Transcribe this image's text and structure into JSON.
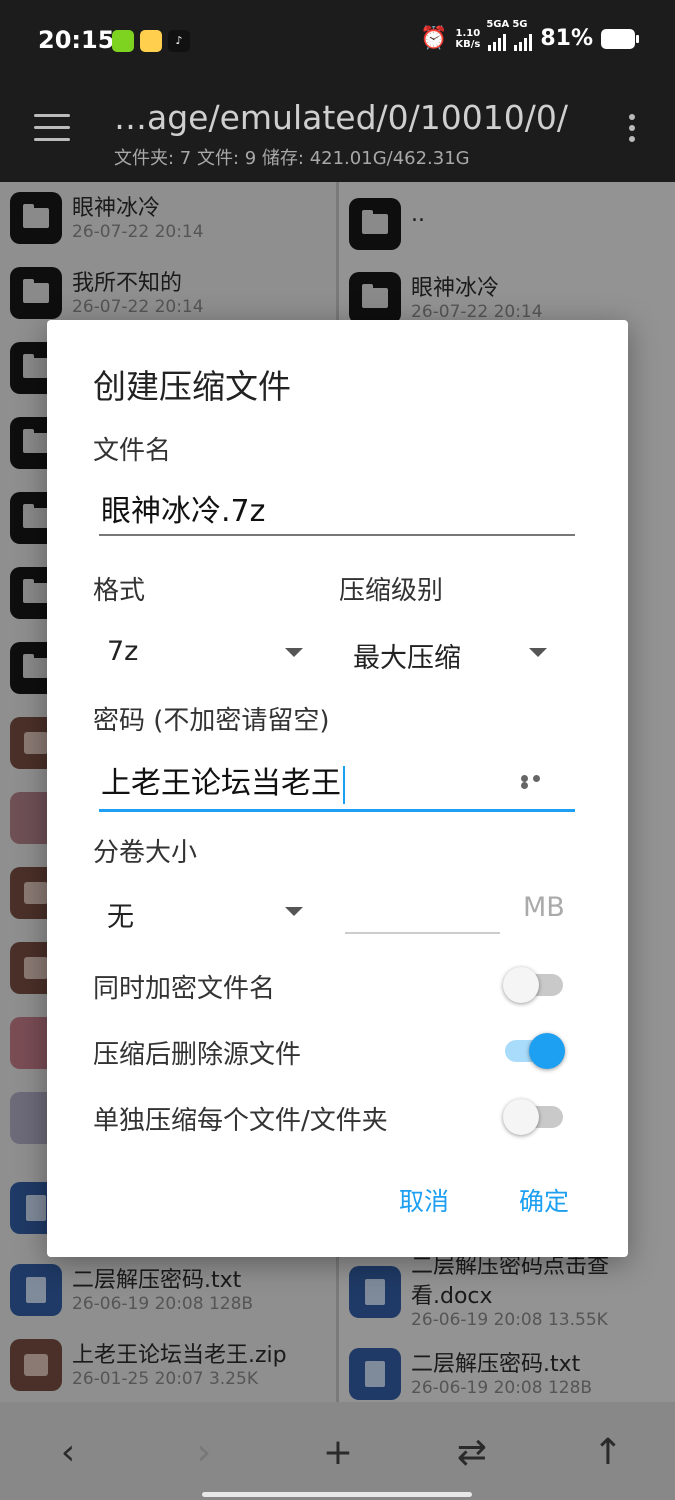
{
  "status": {
    "time": "20:15",
    "net_speed_value": "1.10",
    "net_speed_unit": "KB/s",
    "sim1": "5GA",
    "sim2": "5G",
    "battery": "81%"
  },
  "appbar": {
    "path": "…age/emulated/0/10010/0/",
    "info": "文件夹: 7  文件: 9  储存: 421.01G/462.31G"
  },
  "left_files": [
    {
      "name": "眼神冰冷",
      "meta": "26-07-22 20:14"
    },
    {
      "name": "我所不知的",
      "meta": "26-07-22 20:14"
    },
    {
      "name": "二层解压密码.txt",
      "meta": "26-06-19 20:08  128B"
    },
    {
      "name": "上老王论坛当老王.zip",
      "meta": "26-01-25 20:07  3.25K"
    }
  ],
  "right_files": [
    {
      "name": "..",
      "meta": ""
    },
    {
      "name": "眼神冰冷",
      "meta": "26-07-22 20:14"
    },
    {
      "name": "二层解压密码点击查",
      "meta": ""
    },
    {
      "name": "看.docx",
      "meta": "26-06-19 20:08  13.55K"
    },
    {
      "name": "二层解压密码.txt",
      "meta": "26-06-19 20:08  128B"
    }
  ],
  "dialog": {
    "title": "创建压缩文件",
    "filename_label": "文件名",
    "filename_value": "眼神冰冷.7z",
    "format_label": "格式",
    "format_value": "7z",
    "level_label": "压缩级别",
    "level_value": "最大压缩",
    "password_label": "密码 (不加密请留空)",
    "password_value": "上老王论坛当老王",
    "volume_label": "分卷大小",
    "volume_value": "无",
    "volume_unit": "MB",
    "encrypt_names_label": "同时加密文件名",
    "encrypt_names_on": false,
    "delete_source_label": "压缩后删除源文件",
    "delete_source_on": true,
    "separate_label": "单独压缩每个文件/文件夹",
    "separate_on": false,
    "cancel": "取消",
    "ok": "确定"
  },
  "colors": {
    "accent": "#1ea0f2",
    "dark_bar": "#1c1c1c"
  }
}
